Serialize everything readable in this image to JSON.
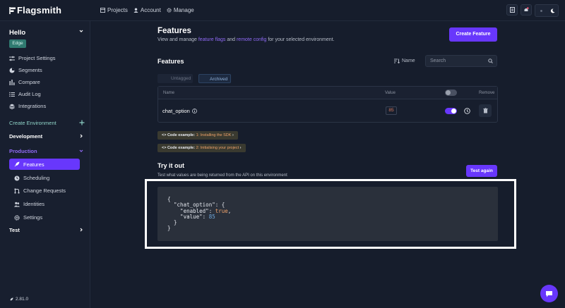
{
  "app": {
    "logo_text": "Flagsmith",
    "version": "2.81.0"
  },
  "colors": {
    "accent": "#6837fc",
    "background": "#161d2c",
    "link": "#906af6",
    "env_badge": "#2f7a70"
  },
  "topnav": {
    "projects": "Projects",
    "account": "Account",
    "manage": "Manage"
  },
  "sidebar": {
    "project_name": "Hello",
    "env_badge": "Edge",
    "items": [
      {
        "label": "Project Settings",
        "icon": "sliders-icon"
      },
      {
        "label": "Segments",
        "icon": "pie-chart-icon"
      },
      {
        "label": "Compare",
        "icon": "bar-chart-icon"
      },
      {
        "label": "Audit Log",
        "icon": "list-icon"
      },
      {
        "label": "Integrations",
        "icon": "layers-icon"
      }
    ],
    "create_env": "Create Environment",
    "environments": [
      {
        "name": "Development"
      },
      {
        "name": "Production"
      },
      {
        "name": "Test"
      }
    ],
    "production_items": [
      {
        "label": "Features",
        "icon": "rocket-icon",
        "active": true
      },
      {
        "label": "Scheduling",
        "icon": "clock-icon"
      },
      {
        "label": "Change Requests",
        "icon": "git-branch-icon"
      },
      {
        "label": "Identities",
        "icon": "users-icon"
      },
      {
        "label": "Settings",
        "icon": "gear-icon"
      }
    ]
  },
  "main": {
    "title": "Features",
    "subtitle_pre": "View and manage ",
    "subtitle_link1": "feature flags",
    "subtitle_mid": " and ",
    "subtitle_link2": "remote config",
    "subtitle_post": " for your selected environment.",
    "create_button": "Create Feature",
    "section_title": "Features",
    "sort_label": "Name",
    "search_placeholder": "Search",
    "tags": {
      "untagged": "Untagged",
      "archived": "Archived"
    },
    "table": {
      "headers": {
        "name": "Name",
        "value": "Value",
        "remove": "Remove"
      },
      "rows": [
        {
          "name": "chat_option",
          "value": "85",
          "enabled": true
        }
      ]
    },
    "code_examples": [
      {
        "prefix": "<> Code example: ",
        "highlight": "1: Installing the SDK",
        "suffix": " ›"
      },
      {
        "prefix": "<> Code example: ",
        "highlight": "2: Initialising your project",
        "suffix": " ›"
      }
    ],
    "try_title": "Try it out",
    "try_sub": "Test what values are being returned from the API on this environment",
    "test_button": "Test again",
    "code": {
      "l1": "{",
      "l2": "  \"chat_option\": {",
      "l3_key": "    \"enabled\": ",
      "l3_val": "true",
      "l4_key": "    \"value\": ",
      "l4_val": "85",
      "l5": "  }",
      "l6": "}"
    }
  }
}
